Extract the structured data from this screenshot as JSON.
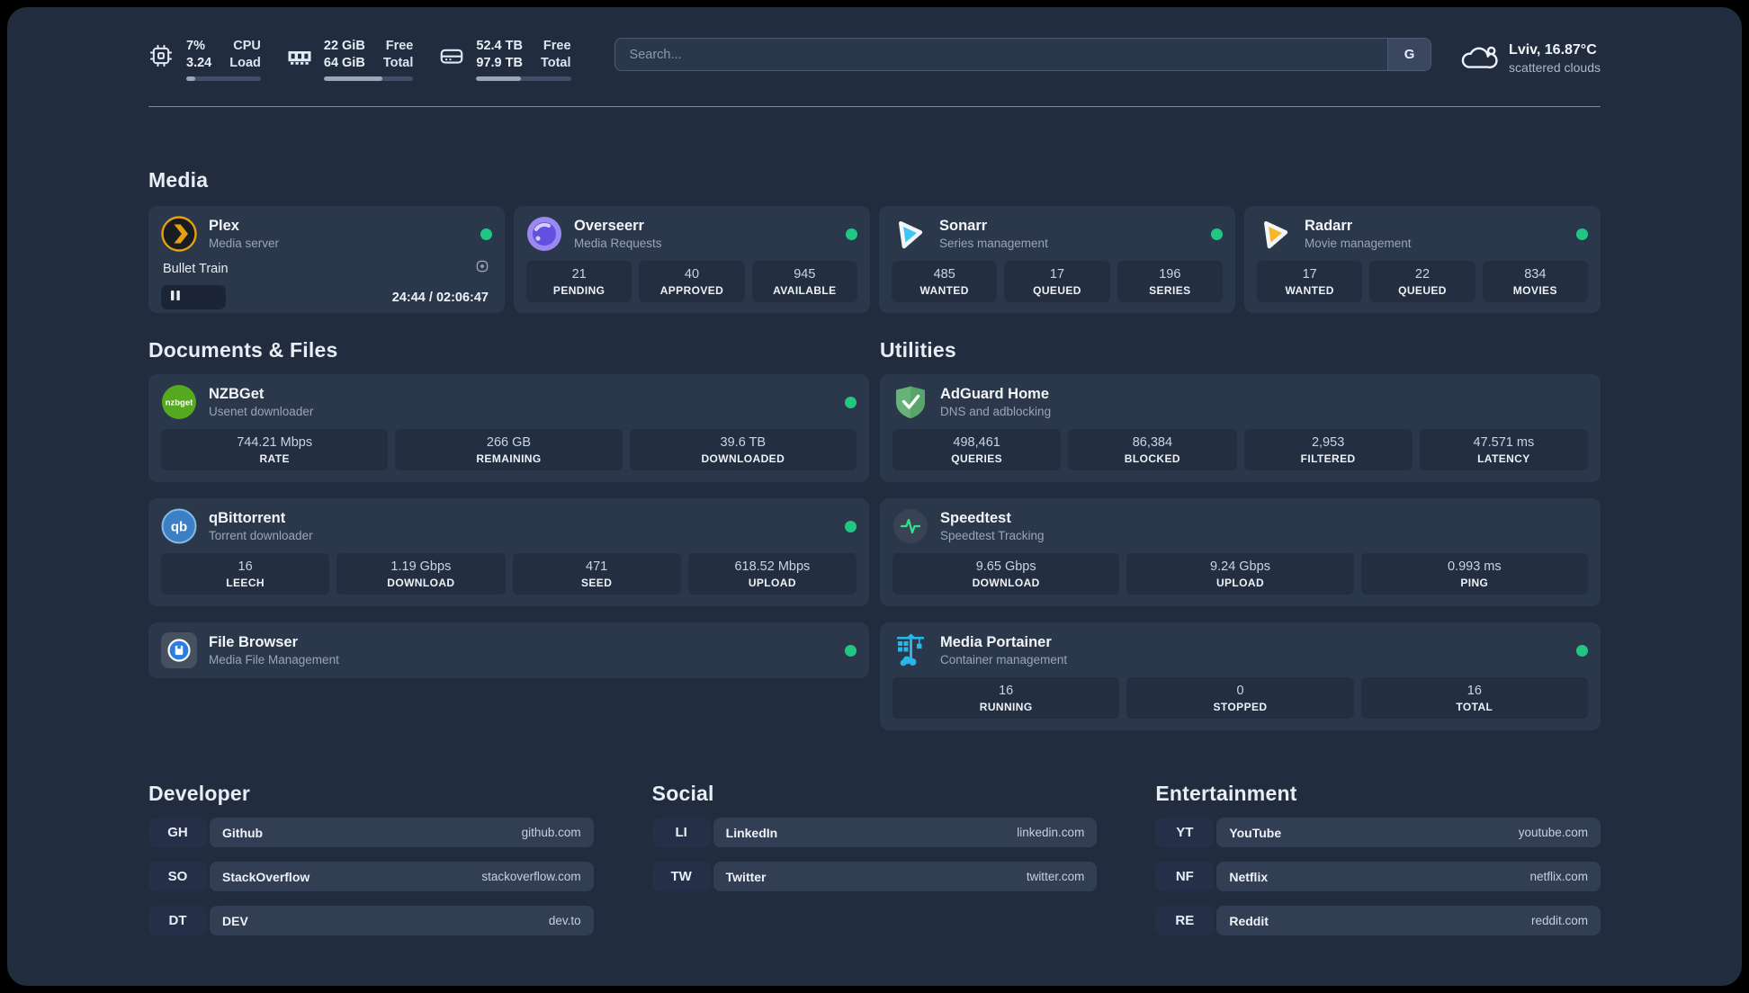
{
  "system": {
    "cpu": {
      "value_top": "7%",
      "value_bottom": "3.24",
      "label_top": "CPU",
      "label_bottom": "Load",
      "progress": 12
    },
    "ram": {
      "value_top": "22 GiB",
      "value_bottom": "64 GiB",
      "label_top": "Free",
      "label_bottom": "Total",
      "progress": 65
    },
    "disk": {
      "value_top": "52.4 TB",
      "value_bottom": "97.9 TB",
      "label_top": "Free",
      "label_bottom": "Total",
      "progress": 47
    }
  },
  "search": {
    "placeholder": "Search...",
    "engine_button": "G"
  },
  "weather": {
    "location_temp": "Lviv, 16.87°C",
    "condition": "scattered clouds"
  },
  "sections": {
    "media": "Media",
    "documents": "Documents & Files",
    "utilities": "Utilities",
    "developer": "Developer",
    "social": "Social",
    "entertainment": "Entertainment"
  },
  "apps": {
    "plex": {
      "name": "Plex",
      "description": "Media server",
      "player": {
        "title": "Bullet Train",
        "time": "24:44 / 02:06:47",
        "progress": 19.5
      }
    },
    "overseerr": {
      "name": "Overseerr",
      "description": "Media Requests",
      "stats": [
        {
          "value": "21",
          "label": "PENDING"
        },
        {
          "value": "40",
          "label": "APPROVED"
        },
        {
          "value": "945",
          "label": "AVAILABLE"
        }
      ]
    },
    "sonarr": {
      "name": "Sonarr",
      "description": "Series management",
      "stats": [
        {
          "value": "485",
          "label": "WANTED"
        },
        {
          "value": "17",
          "label": "QUEUED"
        },
        {
          "value": "196",
          "label": "SERIES"
        }
      ]
    },
    "radarr": {
      "name": "Radarr",
      "description": "Movie management",
      "stats": [
        {
          "value": "17",
          "label": "WANTED"
        },
        {
          "value": "22",
          "label": "QUEUED"
        },
        {
          "value": "834",
          "label": "MOVIES"
        }
      ]
    },
    "nzbget": {
      "name": "NZBGet",
      "description": "Usenet downloader",
      "stats": [
        {
          "value": "744.21 Mbps",
          "label": "RATE"
        },
        {
          "value": "266 GB",
          "label": "REMAINING"
        },
        {
          "value": "39.6 TB",
          "label": "DOWNLOADED"
        }
      ]
    },
    "qbittorrent": {
      "name": "qBittorrent",
      "description": "Torrent downloader",
      "stats": [
        {
          "value": "16",
          "label": "LEECH"
        },
        {
          "value": "1.19 Gbps",
          "label": "DOWNLOAD"
        },
        {
          "value": "471",
          "label": "SEED"
        },
        {
          "value": "618.52 Mbps",
          "label": "UPLOAD"
        }
      ]
    },
    "filebrowser": {
      "name": "File Browser",
      "description": "Media File Management"
    },
    "adguard": {
      "name": "AdGuard Home",
      "description": "DNS and adblocking",
      "stats": [
        {
          "value": "498,461",
          "label": "QUERIES"
        },
        {
          "value": "86,384",
          "label": "BLOCKED"
        },
        {
          "value": "2,953",
          "label": "FILTERED"
        },
        {
          "value": "47.571 ms",
          "label": "LATENCY"
        }
      ]
    },
    "speedtest": {
      "name": "Speedtest",
      "description": "Speedtest Tracking",
      "stats": [
        {
          "value": "9.65 Gbps",
          "label": "DOWNLOAD"
        },
        {
          "value": "9.24 Gbps",
          "label": "UPLOAD"
        },
        {
          "value": "0.993 ms",
          "label": "PING"
        }
      ]
    },
    "portainer": {
      "name": "Media Portainer",
      "description": "Container management",
      "stats": [
        {
          "value": "16",
          "label": "RUNNING"
        },
        {
          "value": "0",
          "label": "STOPPED"
        },
        {
          "value": "16",
          "label": "TOTAL"
        }
      ]
    }
  },
  "links": {
    "developer": [
      {
        "abbr": "GH",
        "name": "Github",
        "url": "github.com"
      },
      {
        "abbr": "SO",
        "name": "StackOverflow",
        "url": "stackoverflow.com"
      },
      {
        "abbr": "DT",
        "name": "DEV",
        "url": "dev.to"
      }
    ],
    "social": [
      {
        "abbr": "LI",
        "name": "LinkedIn",
        "url": "linkedin.com"
      },
      {
        "abbr": "TW",
        "name": "Twitter",
        "url": "twitter.com"
      }
    ],
    "entertainment": [
      {
        "abbr": "YT",
        "name": "YouTube",
        "url": "youtube.com"
      },
      {
        "abbr": "NF",
        "name": "Netflix",
        "url": "netflix.com"
      },
      {
        "abbr": "RE",
        "name": "Reddit",
        "url": "reddit.com"
      }
    ]
  },
  "colors": {
    "status_online": "#22c683",
    "background": "#212c3e",
    "card": "#2b374a"
  }
}
